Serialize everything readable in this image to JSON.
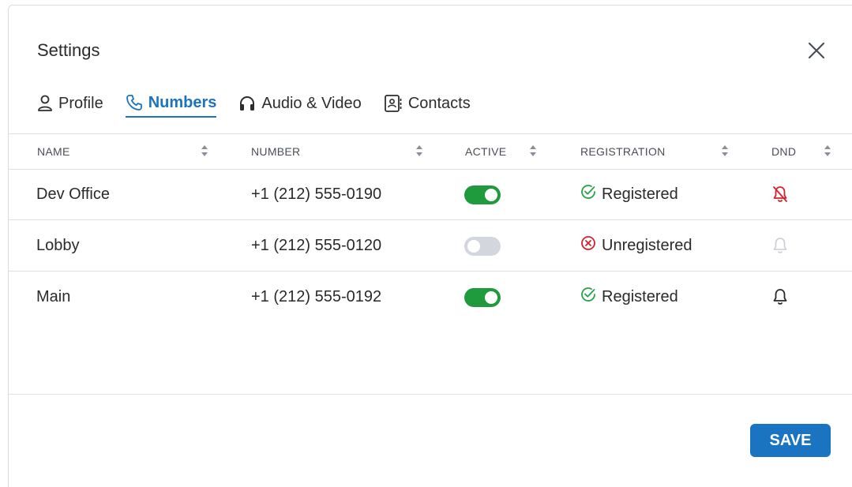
{
  "dialog": {
    "title": "Settings"
  },
  "tabs": [
    {
      "label": "Profile",
      "icon": "person-icon",
      "active": false
    },
    {
      "label": "Numbers",
      "icon": "phone-icon",
      "active": true
    },
    {
      "label": "Audio & Video",
      "icon": "headphones-icon",
      "active": false
    },
    {
      "label": "Contacts",
      "icon": "contact-card-icon",
      "active": false
    }
  ],
  "table": {
    "columns": [
      "NAME",
      "NUMBER",
      "ACTIVE",
      "REGISTRATION",
      "DND"
    ],
    "rows": [
      {
        "name": "Dev Office",
        "number": "+1 (212) 555-0190",
        "active": true,
        "registration": "Registered",
        "dnd": "bell-slash-icon"
      },
      {
        "name": "Lobby",
        "number": "+1 (212) 555-0120",
        "active": false,
        "registration": "Unregistered",
        "dnd": "bell-disabled-icon"
      },
      {
        "name": "Main",
        "number": "+1 (212) 555-0192",
        "active": true,
        "registration": "Registered",
        "dnd": "bell-icon"
      }
    ]
  },
  "footer": {
    "save_label": "SAVE"
  },
  "colors": {
    "accent": "#1a74c2",
    "toggle_on": "#1f9a3c",
    "toggle_off": "#d3d7dd",
    "registered": "#2aa147",
    "unregistered": "#d6202f",
    "dnd_on": "#d6202f"
  }
}
